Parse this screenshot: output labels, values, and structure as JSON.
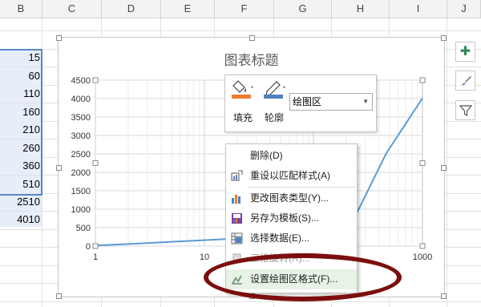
{
  "columns": [
    "B",
    "C",
    "D",
    "E",
    "F",
    "G",
    "H",
    "I",
    "J"
  ],
  "cells": [
    "15",
    "60",
    "110",
    "160",
    "210",
    "260",
    "360",
    "510",
    "2510",
    "4010"
  ],
  "chart": {
    "title": "图表标题"
  },
  "chart_data": {
    "type": "line",
    "title": "图表标题",
    "y_ticks": [
      "4500",
      "4000",
      "3500",
      "3000",
      "2500",
      "2000",
      "1500",
      "1000",
      "500",
      "0"
    ],
    "x_ticks": [
      "1",
      "10",
      "1000"
    ],
    "ylim": [
      0,
      4500
    ],
    "xlim": [
      1,
      1000
    ],
    "x_scale": "log",
    "grid": true,
    "series": [
      {
        "values": [
          15,
          60,
          110,
          160,
          210,
          260,
          360,
          510,
          2510,
          4010
        ],
        "color": "#5b9bd5"
      }
    ]
  },
  "toolbar": {
    "fill_label": "填充",
    "outline_label": "轮廓",
    "combo_value": "绘图区",
    "fill_color": "#ed7d31",
    "outline_color": "#4f81bd"
  },
  "menu": {
    "items": [
      {
        "label": "删除(D)",
        "icon": ""
      },
      {
        "label": "重设以匹配样式(A)",
        "icon": "reset-style-icon"
      },
      {
        "label": "更改图表类型(Y)...",
        "icon": "chart-type-icon"
      },
      {
        "label": "另存为模板(S)...",
        "icon": "save-template-icon"
      },
      {
        "label": "选择数据(E)...",
        "icon": "select-data-icon"
      },
      {
        "label": "三维旋转(R)...",
        "icon": "3d-rotate-icon"
      },
      {
        "label": "设置绘图区格式(F)...",
        "icon": "format-plot-area-icon"
      }
    ]
  },
  "side_buttons": [
    "chart-elements-icon",
    "chart-styles-icon",
    "chart-filters-icon"
  ],
  "highlight_color": "#7c0e0e"
}
